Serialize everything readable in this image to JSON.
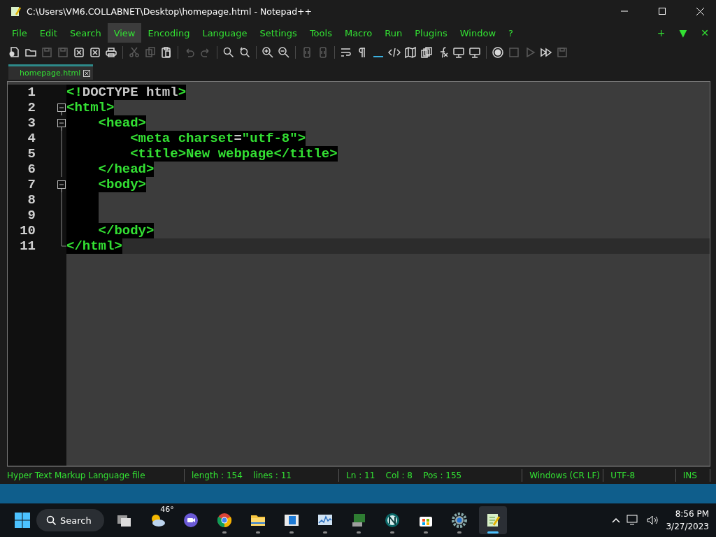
{
  "window": {
    "title": "C:\\Users\\VM6.COLLABNET\\Desktop\\homepage.html - Notepad++"
  },
  "menu": [
    {
      "label": "File",
      "selected": false
    },
    {
      "label": "Edit",
      "selected": false
    },
    {
      "label": "Search",
      "selected": false
    },
    {
      "label": "View",
      "selected": true
    },
    {
      "label": "Encoding",
      "selected": false
    },
    {
      "label": "Language",
      "selected": false
    },
    {
      "label": "Settings",
      "selected": false
    },
    {
      "label": "Tools",
      "selected": false
    },
    {
      "label": "Macro",
      "selected": false
    },
    {
      "label": "Run",
      "selected": false
    },
    {
      "label": "Plugins",
      "selected": false
    },
    {
      "label": "Window",
      "selected": false
    },
    {
      "label": "?",
      "selected": false
    }
  ],
  "menu_extras": [
    "+",
    "▼",
    "✕"
  ],
  "toolbar": [
    {
      "kind": "new",
      "disabled": false
    },
    {
      "kind": "open",
      "disabled": false
    },
    {
      "kind": "save",
      "disabled": true
    },
    {
      "kind": "save",
      "disabled": true
    },
    {
      "kind": "close",
      "disabled": false
    },
    {
      "kind": "close",
      "disabled": false
    },
    {
      "kind": "print",
      "disabled": false
    },
    {
      "kind": "sep"
    },
    {
      "kind": "cut",
      "disabled": true
    },
    {
      "kind": "copy",
      "disabled": true
    },
    {
      "kind": "paste",
      "disabled": false
    },
    {
      "kind": "sep"
    },
    {
      "kind": "undo",
      "disabled": true
    },
    {
      "kind": "redo",
      "disabled": true
    },
    {
      "kind": "sep"
    },
    {
      "kind": "find",
      "disabled": false
    },
    {
      "kind": "replace",
      "disabled": false
    },
    {
      "kind": "sep"
    },
    {
      "kind": "zoomin",
      "disabled": false
    },
    {
      "kind": "zoomout",
      "disabled": false
    },
    {
      "kind": "sep"
    },
    {
      "kind": "sync",
      "disabled": true
    },
    {
      "kind": "sync",
      "disabled": true
    },
    {
      "kind": "sep"
    },
    {
      "kind": "wrap",
      "disabled": false
    },
    {
      "kind": "pilcrow",
      "disabled": false
    },
    {
      "kind": "guide",
      "disabled": false
    },
    {
      "kind": "code",
      "disabled": false
    },
    {
      "kind": "map",
      "disabled": false
    },
    {
      "kind": "docs",
      "disabled": false
    },
    {
      "kind": "function",
      "disabled": false
    },
    {
      "kind": "monitor",
      "disabled": false
    },
    {
      "kind": "monitor",
      "disabled": false
    },
    {
      "kind": "sep"
    },
    {
      "kind": "record",
      "disabled": false
    },
    {
      "kind": "stop",
      "disabled": true
    },
    {
      "kind": "play",
      "disabled": true
    },
    {
      "kind": "fastforward",
      "disabled": false
    },
    {
      "kind": "save",
      "disabled": true
    }
  ],
  "tabs": [
    {
      "label": "homepage.html",
      "selected": true
    }
  ],
  "editor": {
    "lines": [
      {
        "number": "1",
        "kind": "plain",
        "current": false,
        "segments": [
          {
            "text": "<!",
            "kind": "tag"
          },
          {
            "text": "DOCTYPE html",
            "kind": "plain"
          },
          {
            "text": ">",
            "kind": "tag"
          }
        ]
      },
      {
        "number": "2",
        "kind": "fold_start",
        "current": false,
        "segments": [
          {
            "text": "<html>",
            "kind": "tag"
          }
        ]
      },
      {
        "number": "3",
        "kind": "fold_start",
        "current": false,
        "segments": [
          {
            "text": "    <head>",
            "kind": "tag"
          }
        ]
      },
      {
        "number": "4",
        "kind": "fold_body",
        "current": false,
        "segments": [
          {
            "text": "        <meta charset",
            "kind": "tag"
          },
          {
            "text": "=",
            "kind": "plain"
          },
          {
            "text": "\"utf-8\">",
            "kind": "tag"
          }
        ]
      },
      {
        "number": "5",
        "kind": "fold_body",
        "current": false,
        "segments": [
          {
            "text": "        <title>New webpage</title>",
            "kind": "tag"
          }
        ]
      },
      {
        "number": "6",
        "kind": "fold_body",
        "current": false,
        "segments": [
          {
            "text": "    </head>",
            "kind": "tag"
          }
        ]
      },
      {
        "number": "7",
        "kind": "fold_start",
        "current": false,
        "segments": [
          {
            "text": "    <body>",
            "kind": "tag"
          }
        ]
      },
      {
        "number": "8",
        "kind": "fold_body",
        "current": false
      },
      {
        "number": "9",
        "kind": "fold_body",
        "current": false
      },
      {
        "number": "10",
        "kind": "fold_body",
        "current": false,
        "segments": [
          {
            "text": "    </body>",
            "kind": "tag"
          }
        ]
      },
      {
        "number": "11",
        "kind": "fold_end",
        "current": true,
        "segments": [
          {
            "text": "</html>",
            "kind": "tag"
          }
        ]
      }
    ]
  },
  "status_bar": [
    "Hyper Text Markup Language file",
    "length : 154    lines : 11",
    "Ln : 11    Col : 8    Pos : 155",
    "Windows (CR LF)",
    "UTF-8",
    "INS"
  ],
  "taskbar": {
    "search": "Search",
    "weather": "46°",
    "apps": [
      {
        "kind": "taskview",
        "running": false,
        "selected": false
      },
      {
        "kind": "weather",
        "running": false,
        "selected": false
      },
      {
        "kind": "chat",
        "running": false,
        "selected": false
      },
      {
        "kind": "chrome",
        "running": true,
        "selected": false
      },
      {
        "kind": "folder",
        "running": true,
        "selected": false
      },
      {
        "kind": "window",
        "running": true,
        "selected": false
      },
      {
        "kind": "chart",
        "running": true,
        "selected": false
      },
      {
        "kind": "terminal",
        "running": true,
        "selected": false
      },
      {
        "kind": "ncircle",
        "running": true,
        "selected": false
      },
      {
        "kind": "store",
        "running": true,
        "selected": false
      },
      {
        "kind": "gear",
        "running": true,
        "selected": false
      },
      {
        "kind": "notepad",
        "running": true,
        "selected": true
      }
    ],
    "time": "8:56 PM",
    "date": "3/27/2023"
  }
}
